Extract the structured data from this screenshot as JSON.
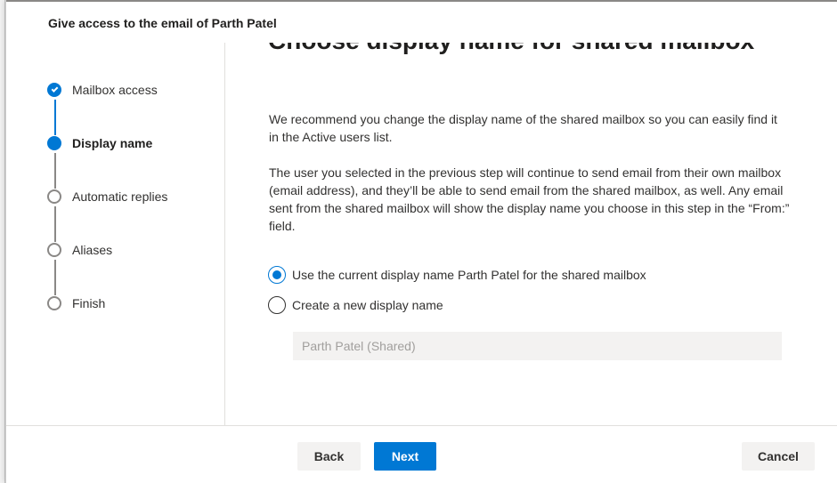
{
  "panel": {
    "title": "Give access to the email of Parth Patel"
  },
  "steps": [
    {
      "label": "Mailbox access",
      "state": "complete",
      "icon": "checkmark-icon"
    },
    {
      "label": "Display name",
      "state": "current"
    },
    {
      "label": "Automatic replies",
      "state": "pending"
    },
    {
      "label": "Aliases",
      "state": "pending"
    },
    {
      "label": "Finish",
      "state": "pending"
    }
  ],
  "main": {
    "heading": "Choose display name for shared mailbox",
    "paragraph1": "We recommend you change the display name of the shared mailbox so you can easily find it in the Active users list.",
    "paragraph2": "The user you selected in the previous step will continue to send email from their own mailbox (email address), and they’ll be able to send email from the shared mailbox, as well. Any email sent from the shared mailbox will show the display name you choose in this step in the “From:” field.",
    "options": [
      {
        "label": "Use the current display name Parth Patel for the shared mailbox",
        "selected": true
      },
      {
        "label": "Create a new display name",
        "selected": false
      }
    ],
    "new_name_input": {
      "value": "",
      "placeholder": "Parth Patel (Shared)"
    }
  },
  "footer": {
    "back_label": "Back",
    "next_label": "Next",
    "cancel_label": "Cancel"
  },
  "colors": {
    "accent": "#0078d4",
    "text": "#323130",
    "muted": "#8a8886"
  }
}
